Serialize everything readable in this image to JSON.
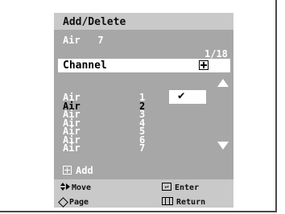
{
  "menu": {
    "title": "Add/Delete",
    "current_channel": "Air   7",
    "counter": "1/18",
    "channel_label": "Channel",
    "selected_row": 1,
    "check_glyph": "✔",
    "items": [
      {
        "band": "Air",
        "number": "1"
      },
      {
        "band": "Air",
        "number": "2"
      },
      {
        "band": "Air",
        "number": "3"
      },
      {
        "band": "Air",
        "number": "4"
      },
      {
        "band": "Air",
        "number": "5"
      },
      {
        "band": "Air",
        "number": "6"
      },
      {
        "band": "Air",
        "number": "7"
      }
    ],
    "add_label": "Add"
  },
  "help": {
    "move": "Move",
    "enter": "Enter",
    "page": "Page",
    "return": "Return"
  },
  "icons": {
    "channel_toggle": "plus-box-icon",
    "scroll_up": "up-arrow-icon",
    "scroll_down": "down-arrow-icon",
    "add": "plus-box-icon",
    "move": "move-arrows-icon",
    "enter": "enter-icon",
    "page": "diamond-icon",
    "return": "menu-return-icon"
  },
  "colors": {
    "panel": "#a7a7a7",
    "title_bar": "#c9c9c9",
    "help_bar": "#c9c9c9",
    "text_light": "#ffffff",
    "text_dark": "#000000",
    "highlight": "#ffffff"
  }
}
